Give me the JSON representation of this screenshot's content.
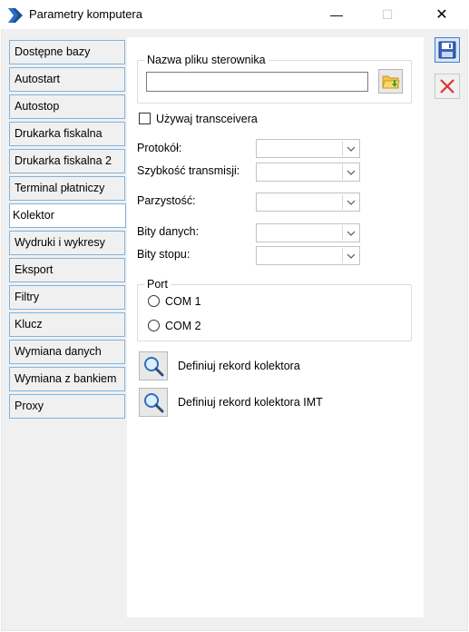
{
  "window": {
    "title": "Parametry komputera",
    "minimize_glyph": "—",
    "maximize_glyph": "☐",
    "close_glyph": "✕"
  },
  "sidebar": {
    "items": [
      {
        "label": "Dostępne bazy",
        "active": false
      },
      {
        "label": "Autostart",
        "active": false
      },
      {
        "label": "Autostop",
        "active": false
      },
      {
        "label": "Drukarka fiskalna",
        "active": false
      },
      {
        "label": "Drukarka fiskalna 2",
        "active": false
      },
      {
        "label": "Terminal płatniczy",
        "active": false
      },
      {
        "label": "Kolektor",
        "active": true
      },
      {
        "label": "Wydruki i wykresy",
        "active": false
      },
      {
        "label": "Eksport",
        "active": false
      },
      {
        "label": "Filtry",
        "active": false
      },
      {
        "label": "Klucz",
        "active": false
      },
      {
        "label": "Wymiana danych",
        "active": false
      },
      {
        "label": "Wymiana z bankiem",
        "active": false
      },
      {
        "label": "Proxy",
        "active": false
      }
    ]
  },
  "driver": {
    "group_title": "Nazwa pliku sterownika",
    "file_value": ""
  },
  "transceiver": {
    "label": "Używaj transceivera",
    "checked": false
  },
  "fields": {
    "protocol_label": "Protokół:",
    "protocol_value": "",
    "speed_label": "Szybkość transmisji:",
    "speed_value": "",
    "parity_label": "Parzystość:",
    "parity_value": "",
    "databits_label": "Bity danych:",
    "databits_value": "",
    "stopbits_label": "Bity stopu:",
    "stopbits_value": ""
  },
  "port": {
    "group_title": "Port",
    "com1_label": "COM 1",
    "com2_label": "COM 2",
    "selected": ""
  },
  "actions": {
    "define_record_label": "Definiuj rekord kolektora",
    "define_record_imt_label": "Definiuj rekord kolektora IMT"
  },
  "icons": {
    "app": "app-logo-icon",
    "folder": "folder-open-icon",
    "magnifier": "magnifier-icon",
    "save": "floppy-disk-icon",
    "cancel": "red-x-icon"
  },
  "colors": {
    "tab_border": "#7fb4e0",
    "save_accent": "#3c7fd0",
    "cancel_red": "#e03030"
  }
}
